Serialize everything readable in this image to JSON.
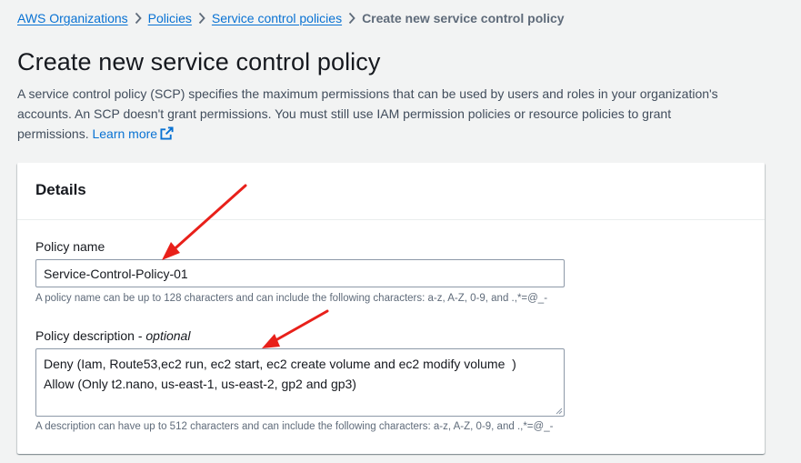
{
  "breadcrumb": {
    "items": [
      "AWS Organizations",
      "Policies",
      "Service control policies"
    ],
    "current": "Create new service control policy"
  },
  "header": {
    "title": "Create new service control policy",
    "description": "A service control policy (SCP) specifies the maximum permissions that can be used by users and roles in your organization's accounts. An SCP doesn't grant permissions. You must still use IAM permission policies or resource policies to grant permissions.",
    "learn_more": "Learn more"
  },
  "details": {
    "title": "Details",
    "policy_name": {
      "label": "Policy name",
      "value": "Service-Control-Policy-01",
      "hint": "A policy name can be up to 128 characters and can include the following characters: a-z, A-Z, 0-9, and .,*=@_-"
    },
    "policy_description": {
      "label": "Policy description - ",
      "optional": "optional",
      "value": "Deny (Iam, Route53,ec2 run, ec2 start, ec2 create volume and ec2 modify volume  )\nAllow (Only t2.nano, us-east-1, us-east-2, gp2 and gp3)",
      "hint": "A description can have up to 512 characters and can include the following characters: a-z, A-Z, 0-9, and .,*=@_-"
    }
  },
  "colors": {
    "link": "#0972d3",
    "annotation_arrow": "#e8201a",
    "page_background": "#f2f3f3"
  },
  "icons": [
    "chevron-right-icon",
    "external-link-icon",
    "resize-grip-icon",
    "annotation-arrow"
  ]
}
